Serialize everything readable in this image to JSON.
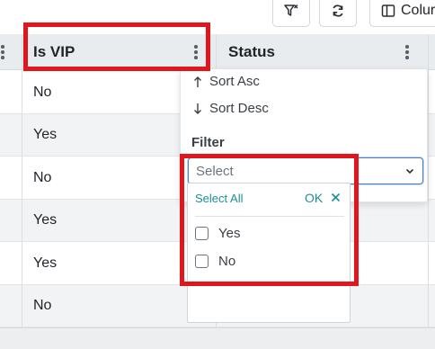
{
  "toolbar": {
    "filter_icon": "clear-filter-icon",
    "refresh_icon": "refresh-icon",
    "columns_icon": "columns-icon",
    "columns_label": "Colur"
  },
  "grid": {
    "columns": [
      {
        "title": "Is VIP"
      },
      {
        "title": "Status"
      }
    ],
    "rows": [
      {
        "is_vip": "No"
      },
      {
        "is_vip": "Yes"
      },
      {
        "is_vip": "No"
      },
      {
        "is_vip": "Yes"
      },
      {
        "is_vip": "Yes"
      },
      {
        "is_vip": "No"
      }
    ]
  },
  "column_menu": {
    "sort_asc": "Sort Asc",
    "sort_desc": "Sort Desc",
    "filter_label": "Filter",
    "select_placeholder": "Select"
  },
  "filter_dropdown": {
    "select_all": "Select All",
    "ok": "OK",
    "options": [
      {
        "label": "Yes",
        "checked": false
      },
      {
        "label": "No",
        "checked": false
      }
    ]
  },
  "colors": {
    "highlight": "#e0161c",
    "link": "#1a8f9e",
    "header_bg": "#e9ecef",
    "focus_border": "#4a7fc1"
  }
}
